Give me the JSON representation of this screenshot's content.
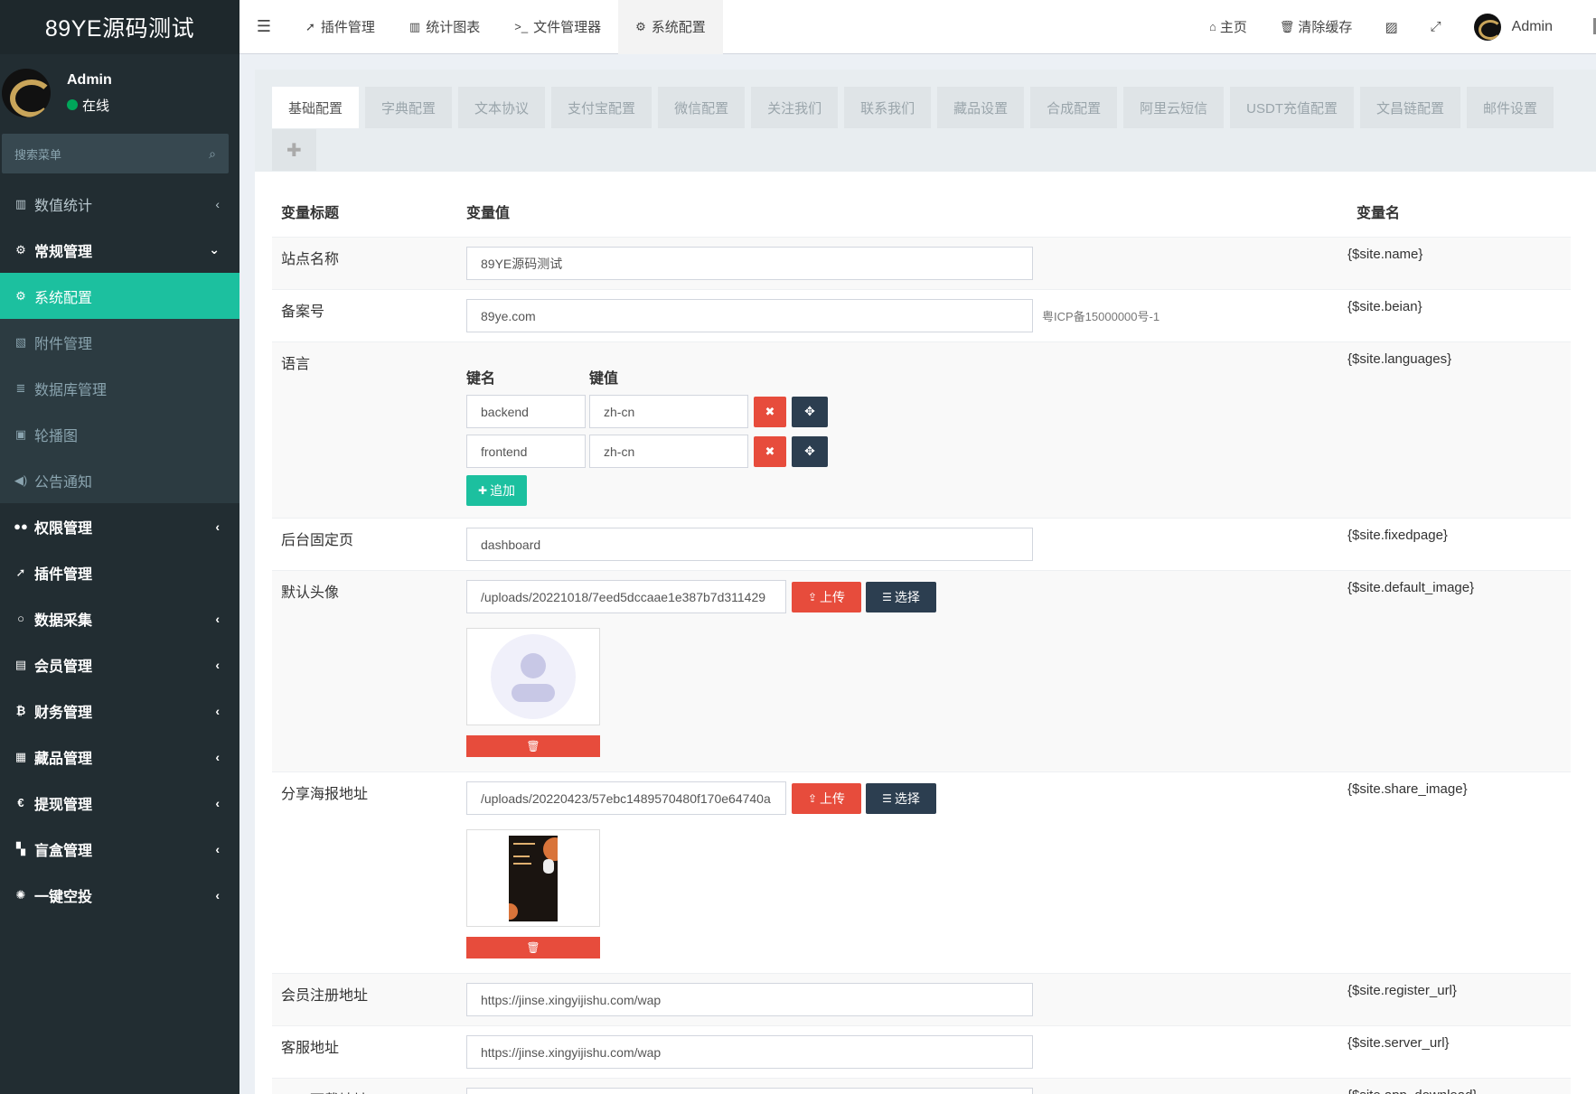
{
  "brand": "89YE源码测试",
  "user": {
    "name": "Admin",
    "status": "在线"
  },
  "sidebar": {
    "search_placeholder": "搜索菜单",
    "items": [
      {
        "label": "数值统计",
        "icon": "bar-chart-icon",
        "glyph": "📊"
      },
      {
        "label": "常规管理",
        "icon": "cogs-icon",
        "glyph": "⚙"
      },
      {
        "label": "系统配置",
        "icon": "gear-icon",
        "glyph": "⚙"
      },
      {
        "label": "附件管理",
        "icon": "image-icon",
        "glyph": "🖼"
      },
      {
        "label": "数据库管理",
        "icon": "database-icon",
        "glyph": "≣"
      },
      {
        "label": "轮播图",
        "icon": "file-image-icon",
        "glyph": "▣"
      },
      {
        "label": "公告通知",
        "icon": "volume-icon",
        "glyph": "🔊"
      },
      {
        "label": "权限管理",
        "icon": "group-icon",
        "glyph": "👥"
      },
      {
        "label": "插件管理",
        "icon": "rocket-icon",
        "glyph": "✈"
      },
      {
        "label": "数据采集",
        "icon": "circle-icon",
        "glyph": "○"
      },
      {
        "label": "会员管理",
        "icon": "address-book-icon",
        "glyph": "▤"
      },
      {
        "label": "财务管理",
        "icon": "bitcoin-icon",
        "glyph": "₿"
      },
      {
        "label": "藏品管理",
        "icon": "calendar-icon",
        "glyph": "▦"
      },
      {
        "label": "提现管理",
        "icon": "euro-icon",
        "glyph": "€"
      },
      {
        "label": "盲盒管理",
        "icon": "th-large-icon",
        "glyph": "▦"
      },
      {
        "label": "一键空投",
        "icon": "joomla-icon",
        "glyph": "✺"
      }
    ]
  },
  "header": {
    "nav": [
      {
        "label": "插件管理",
        "icon": "rocket-icon",
        "glyph": "✈"
      },
      {
        "label": "统计图表",
        "icon": "bar-chart-icon",
        "glyph": "▥"
      },
      {
        "label": "文件管理器",
        "icon": "terminal-icon",
        "glyph": ">_"
      },
      {
        "label": "系统配置",
        "icon": "gear-icon",
        "glyph": "⚙"
      }
    ],
    "right": {
      "home": "主页",
      "clear_cache": "清除缓存",
      "user": "Admin"
    }
  },
  "tabs": [
    "基础配置",
    "字典配置",
    "文本协议",
    "支付宝配置",
    "微信配置",
    "关注我们",
    "联系我们",
    "藏品设置",
    "合成配置",
    "阿里云短信",
    "USDT充值配置",
    "文昌链配置",
    "邮件设置"
  ],
  "table": {
    "head": {
      "title": "变量标题",
      "value": "变量值",
      "name": "变量名"
    },
    "site_name": {
      "title": "站点名称",
      "value": "89YE源码测试",
      "var": "{$site.name}"
    },
    "beian": {
      "title": "备案号",
      "value": "89ye.com",
      "hint": "粤ICP备15000000号-1",
      "var": "{$site.beian}"
    },
    "languages": {
      "title": "语言",
      "var": "{$site.languages}",
      "key_label": "键名",
      "val_label": "键值",
      "rows": [
        {
          "key": "backend",
          "value": "zh-cn"
        },
        {
          "key": "frontend",
          "value": "zh-cn"
        }
      ],
      "add_label": "追加"
    },
    "fixedpage": {
      "title": "后台固定页",
      "value": "dashboard",
      "var": "{$site.fixedpage}"
    },
    "default_image": {
      "title": "默认头像",
      "value": "/uploads/20221018/7eed5dccaae1e387b7d311429",
      "var": "{$site.default_image}"
    },
    "share_image": {
      "title": "分享海报地址",
      "value": "/uploads/20220423/57ebc1489570480f170e64740a",
      "var": "{$site.share_image}"
    },
    "register_url": {
      "title": "会员注册地址",
      "value": "https://jinse.xingyijishu.com/wap",
      "var": "{$site.register_url}"
    },
    "server_url": {
      "title": "客服地址",
      "value": "https://jinse.xingyijishu.com/wap",
      "var": "{$site.server_url}"
    },
    "app_download": {
      "title": "APP下载地址",
      "value": "",
      "var": "{$site.app_download}"
    },
    "upload_label": "上传",
    "choose_label": "选择"
  },
  "colors": {
    "sidebar": "#222d32",
    "active": "#1cc09f",
    "danger": "#e74c3c",
    "dark": "#2c3e50"
  }
}
